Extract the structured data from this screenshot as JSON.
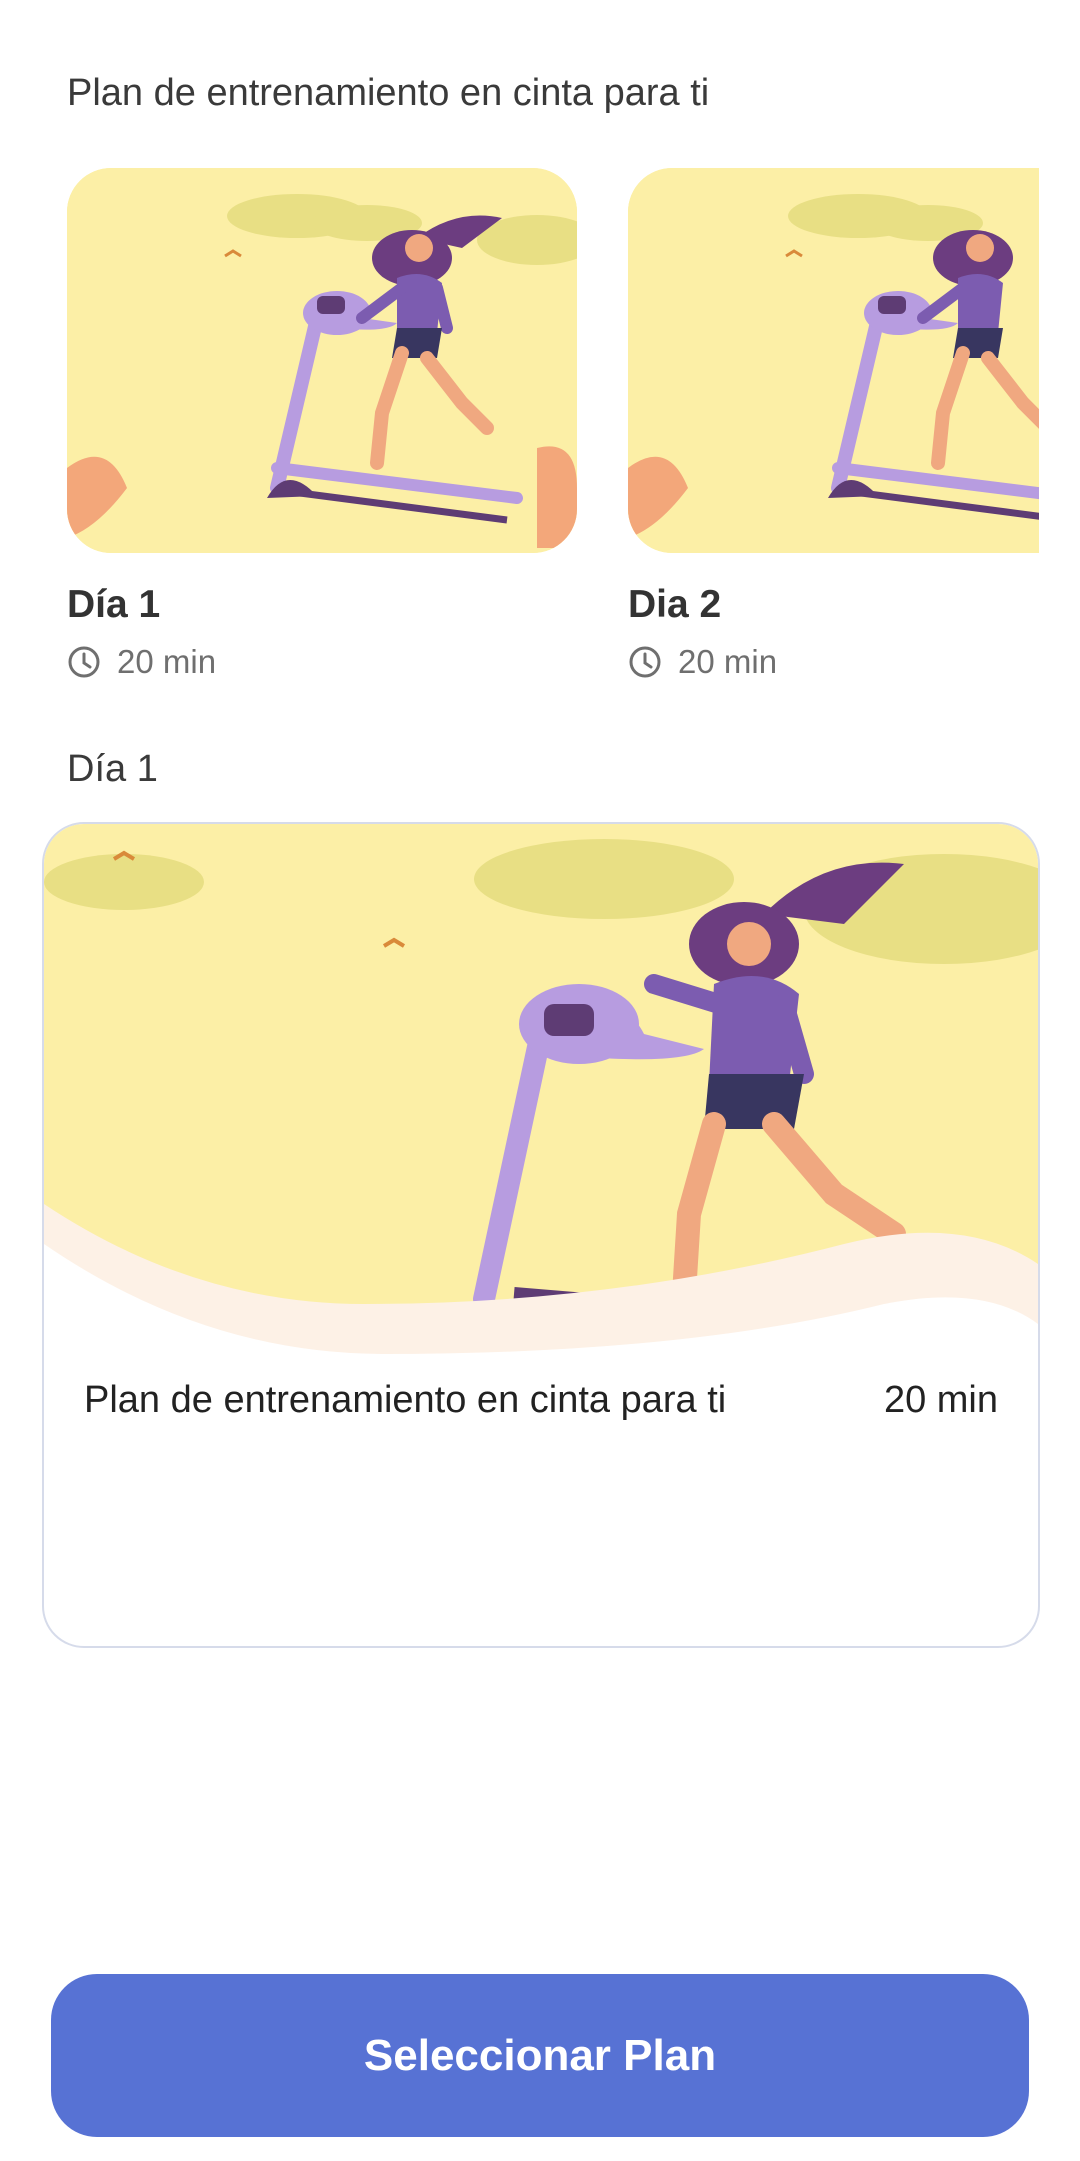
{
  "header": {
    "title": "Plan de entrenamiento en cinta para ti"
  },
  "days": [
    {
      "label": "Día 1",
      "duration": "20 min"
    },
    {
      "label": "Dia 2",
      "duration": "20 min"
    }
  ],
  "selected": {
    "heading": "Día 1",
    "plan_name": "Plan de entrenamiento en cinta para ti",
    "duration": "20 min"
  },
  "cta": {
    "label": "Seleccionar Plan"
  },
  "icons": {
    "duration": "clock-icon",
    "illustration": "treadmill-runner-illustration"
  },
  "colors": {
    "accent": "#5772d4",
    "illustration_bg": "#fcefa6",
    "treadmill": "#b79ce0"
  }
}
